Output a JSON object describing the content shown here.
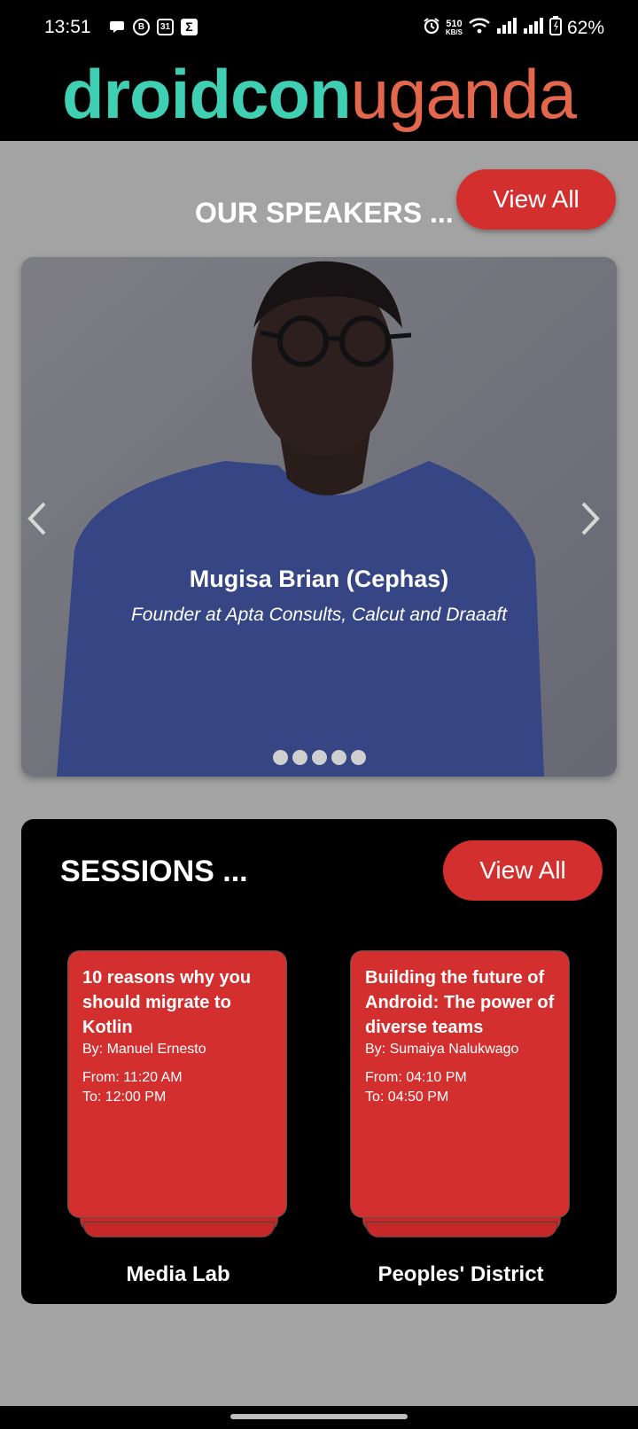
{
  "status_bar": {
    "time": "13:51",
    "left_icons": [
      "chat-icon",
      "b-icon",
      "calendar-31-icon",
      "sigma-icon"
    ],
    "calendar_label": "31",
    "b_label": "B",
    "sigma_label": "Σ",
    "net_speed": "510",
    "net_unit": "KB/S",
    "battery": "62%"
  },
  "header": {
    "logo_part1": "droidcon",
    "logo_part2": "uganda",
    "logo_colors": {
      "part1": "#3fd0b3",
      "part2": "#e4674c"
    }
  },
  "speakers": {
    "title": "OUR SPEAKERS ...",
    "view_all": "View All",
    "current": {
      "name": "Mugisa Brian (Cephas)",
      "role": "Founder at Apta Consults, Calcut and Draaaft"
    },
    "page_count": 5,
    "active_index": 0
  },
  "sessions": {
    "title": "SESSIONS ...",
    "view_all": "View All",
    "items": [
      {
        "title": "10 reasons why you should migrate to Kotlin",
        "by": "By: Manuel Ernesto",
        "from": "From: 11:20 AM",
        "to": "To: 12:00 PM",
        "location": "Media Lab"
      },
      {
        "title": "Building the future of Android: The power of diverse teams",
        "by": "By: Sumaiya Nalukwago",
        "from": "From: 04:10 PM",
        "to": "To: 04:50 PM",
        "location": "Peoples' District"
      }
    ]
  },
  "colors": {
    "accent_red": "#d32f2f",
    "background": "#a3a3a3",
    "header_bg": "#000000"
  }
}
